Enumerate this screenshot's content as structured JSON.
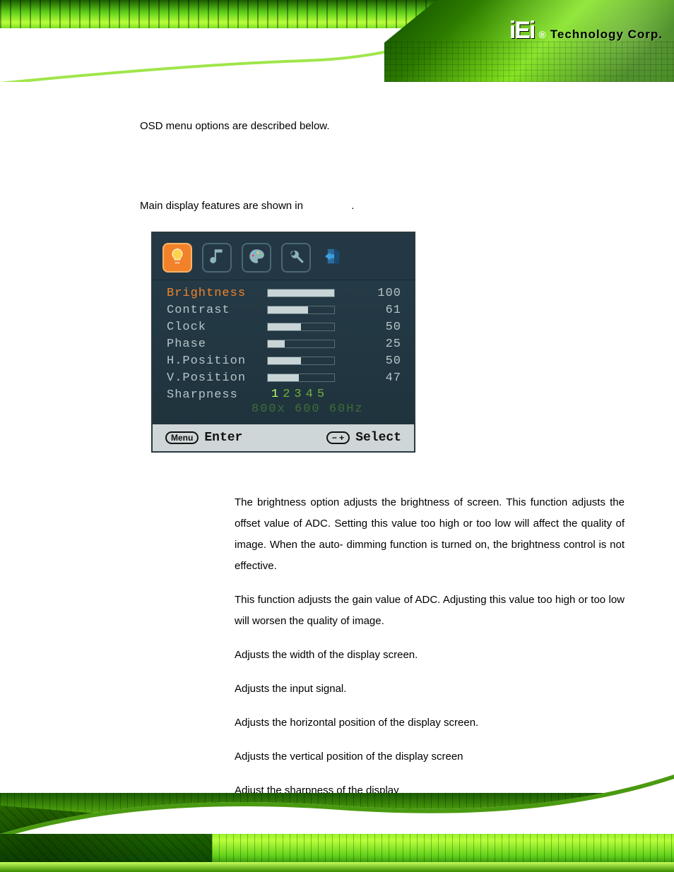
{
  "header": {
    "logo_text": "iEi",
    "registered": "®",
    "corp_text": "Technology Corp."
  },
  "body": {
    "intro": "OSD menu options are described below.",
    "subintro_prefix": "Main display features are shown in ",
    "subintro_suffix": "."
  },
  "osd": {
    "tabs": [
      {
        "name": "display",
        "active": true
      },
      {
        "name": "audio",
        "active": false
      },
      {
        "name": "color",
        "active": false
      },
      {
        "name": "tools",
        "active": false
      },
      {
        "name": "exit",
        "active": false
      }
    ],
    "rows": [
      {
        "label": "Brightness",
        "value": 100,
        "max": 100,
        "active": true
      },
      {
        "label": "Contrast",
        "value": 61,
        "max": 100,
        "active": false
      },
      {
        "label": "Clock",
        "value": 50,
        "max": 100,
        "active": false
      },
      {
        "label": "Phase",
        "value": 25,
        "max": 100,
        "active": false
      },
      {
        "label": "H.Position",
        "value": 50,
        "max": 100,
        "active": false
      },
      {
        "label": "V.Position",
        "value": 47,
        "max": 100,
        "active": false
      }
    ],
    "sharpness_label": "Sharpness",
    "sharpness_scale": [
      "1",
      "2",
      "3",
      "4",
      "5"
    ],
    "resolution": "800x 600 60Hz",
    "footer": {
      "menu_pill": "Menu",
      "enter": "Enter",
      "select_pill": "− +",
      "select": "Select"
    }
  },
  "descriptions": [
    "The brightness option adjusts the brightness of screen. This function adjusts the offset value of ADC. Setting this value too high or too low will affect the quality of image. When the auto- dimming function is turned on, the brightness control is not effective.",
    "This function adjusts the gain value of ADC. Adjusting this value too high or too low will worsen the quality of image.",
    "Adjusts the width of the display screen.",
    "Adjusts the input signal.",
    "Adjusts the horizontal position of the display screen.",
    "Adjusts the vertical position of the display screen",
    "Adjust the sharpness of the display"
  ]
}
